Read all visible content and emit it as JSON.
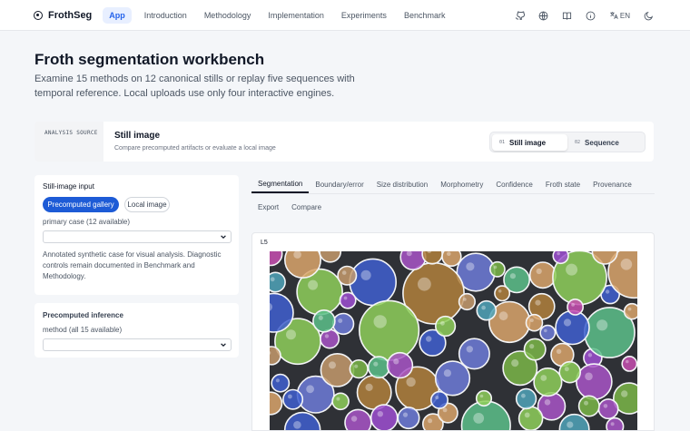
{
  "app": {
    "brand": "FrothSeg",
    "nav": [
      "App",
      "Introduction",
      "Methodology",
      "Implementation",
      "Experiments",
      "Benchmark"
    ],
    "active_nav": 0,
    "lang": "EN",
    "icons": [
      "github-icon",
      "globe-icon",
      "book-icon",
      "info-icon",
      "translate-icon",
      "moon-icon"
    ]
  },
  "hero": {
    "title": "Froth segmentation workbench",
    "description": "Examine 15 methods on 12 canonical stills or replay five sequences with temporal reference. Local uploads use only four interactive engines."
  },
  "source": {
    "tag": "ANALYSIS SOURCE",
    "title": "Still image",
    "subtitle": "Compare precomputed artifacts or evaluate a local image",
    "options": [
      {
        "num": "01",
        "label": "Still image",
        "selected": true
      },
      {
        "num": "02",
        "label": "Sequence",
        "selected": false
      }
    ]
  },
  "still_input": {
    "title": "Still-image input",
    "mode_gallery": "Precomputed gallery",
    "mode_local": "Local image",
    "case_label": "primary case (12 available)",
    "note": "Annotated synthetic case for visual analysis. Diagnostic controls remain documented in Benchmark and Methodology."
  },
  "inference": {
    "title": "Precomputed inference",
    "method_label": "method (all 15 available)"
  },
  "tabs": {
    "row1": [
      "Segmentation",
      "Boundary/error",
      "Size distribution",
      "Morphometry",
      "Confidence",
      "Froth state",
      "Provenance"
    ],
    "row2": [
      "Export",
      "Compare"
    ],
    "selected": "Segmentation"
  },
  "viewer": {
    "label": "L5",
    "palette": [
      "#7ab648",
      "#a855c7",
      "#c49a6c",
      "#3f5fcf",
      "#4fa3b8",
      "#d9a56b",
      "#8ecf5a",
      "#c74fb0",
      "#6d7bd8",
      "#5cc08a",
      "#b0803c",
      "#9d4fd1"
    ]
  }
}
